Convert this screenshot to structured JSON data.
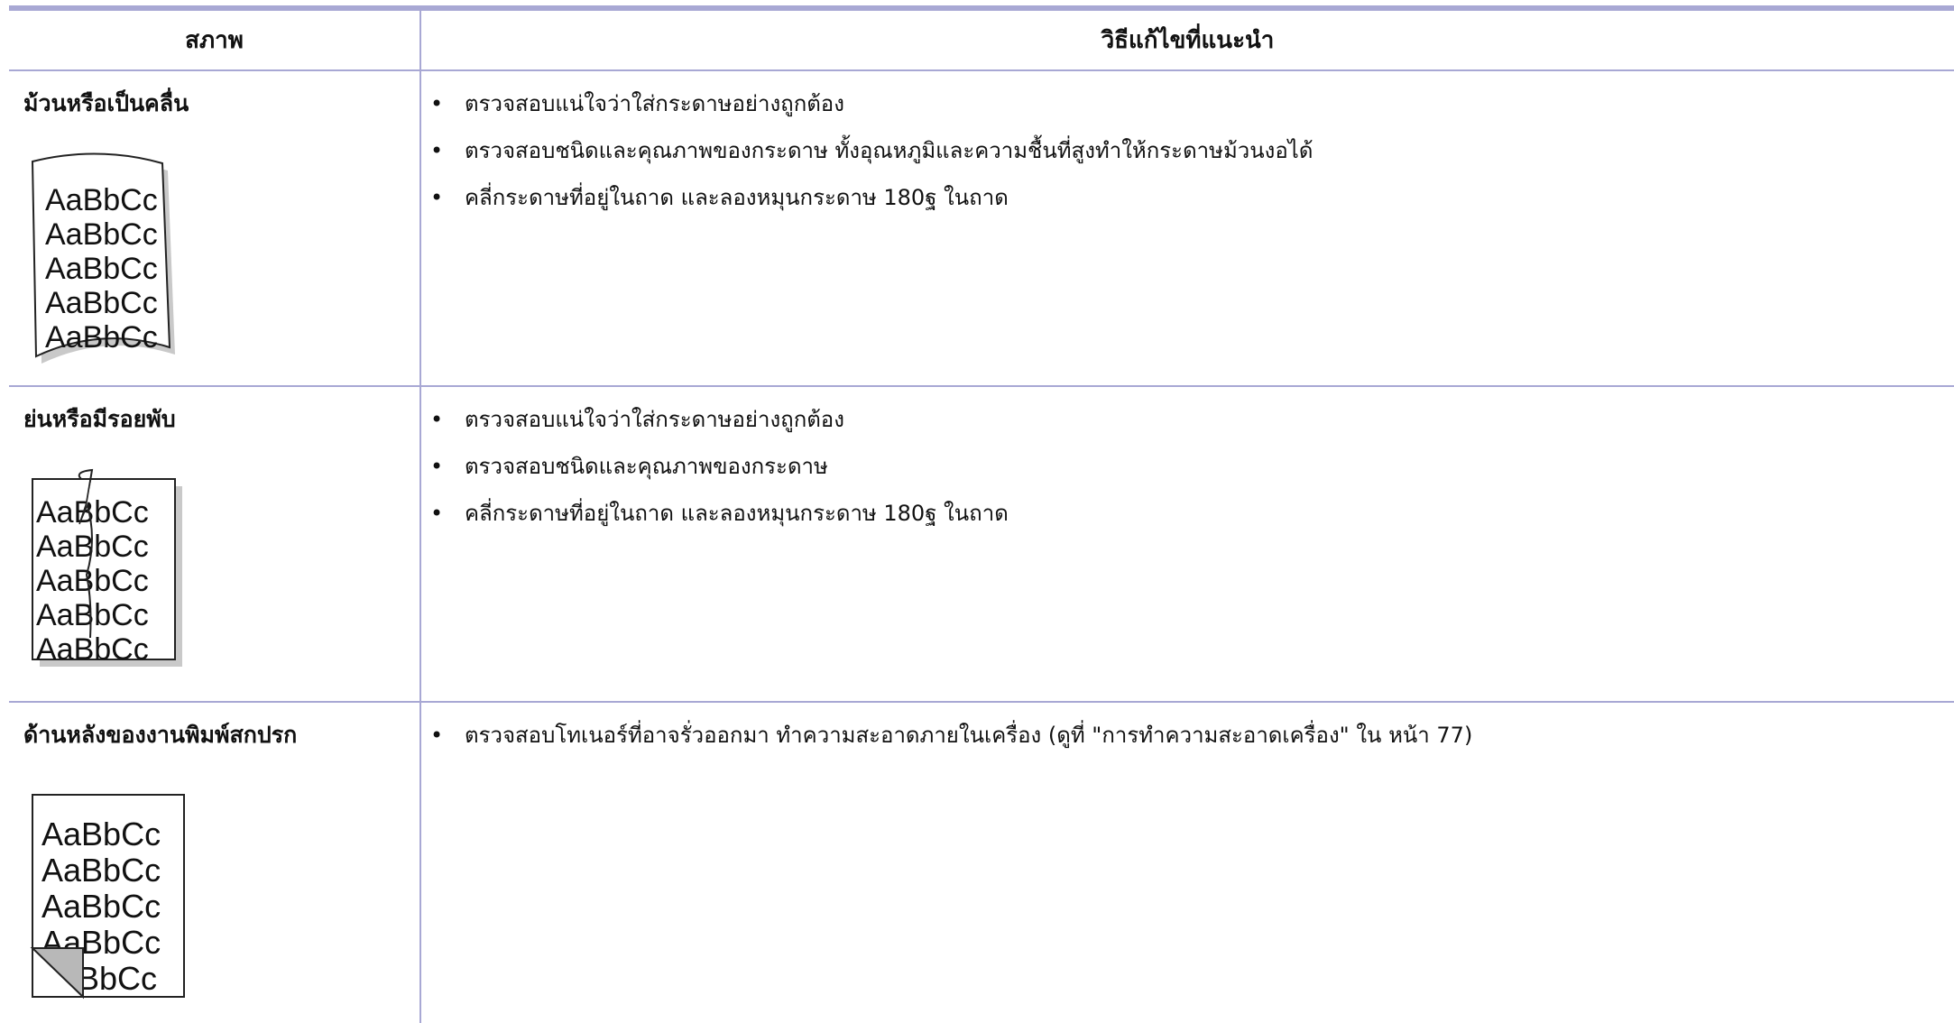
{
  "table": {
    "header": {
      "condition": "สภาพ",
      "solution": "วิธีแก้ไขที่แนะนำ"
    },
    "rows": [
      {
        "condition": "ม้วนหรือเป็นคลื่น",
        "illustration_lines": [
          "AaBbCc",
          "AaBbCc",
          "AaBbCc",
          "AaBbCc",
          "AaBbCc"
        ],
        "solutions": [
          "ตรวจสอบแน่ใจว่าใส่กระดาษอย่างถูกต้อง",
          "ตรวจสอบชนิดและคุณภาพของกระดาษ ทั้งอุณหภูมิและความชื้นที่สูงทำให้กระดาษม้วนงอได้",
          "คลี่กระดาษที่อยู่ในถาด และลองหมุนกระดาษ 180ฐ ในถาด"
        ]
      },
      {
        "condition": "ย่นหรือมีรอยพับ",
        "illustration_lines": [
          "AaBbCc",
          "AaBbCc",
          "AaBbCc",
          "AaBbCc",
          "AaBbCc"
        ],
        "solutions": [
          "ตรวจสอบแน่ใจว่าใส่กระดาษอย่างถูกต้อง",
          "ตรวจสอบชนิดและคุณภาพของกระดาษ",
          "คลี่กระดาษที่อยู่ในถาด และลองหมุนกระดาษ 180ฐ ในถาด"
        ]
      },
      {
        "condition": "ด้านหลังของงานพิมพ์สกปรก",
        "illustration_lines": [
          "AaBbCc",
          "AaBbCc",
          "AaBbCc",
          "AaBbCc",
          "aBbCc"
        ],
        "solutions": [
          "ตรวจสอบโทเนอร์ที่อาจรั่วออกมา ทำความสะอาดภายในเครื่อง (ดูที่ \"การทำความสะอาดเครื่อง\"  ใน หน้า 77)"
        ]
      }
    ],
    "bullet": "•"
  }
}
